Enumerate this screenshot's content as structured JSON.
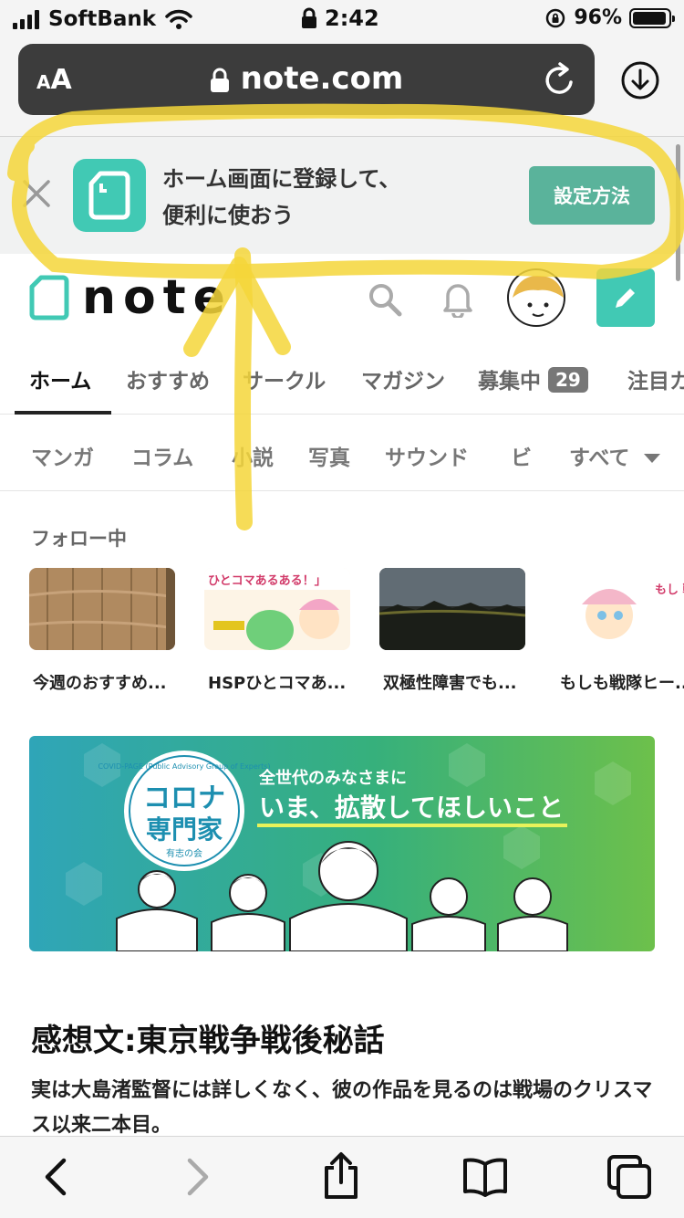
{
  "status_bar": {
    "carrier": "SoftBank",
    "time": "2:42",
    "battery_percent": "96%",
    "battery_level": 0.96
  },
  "address_bar": {
    "text_size_small": "A",
    "text_size_large": "A",
    "domain": "note.com"
  },
  "install_banner": {
    "line1": "ホーム画面に登録して、",
    "line2": "便利に使おう",
    "button": "設定方法"
  },
  "site": {
    "brand": "note"
  },
  "tabs": [
    {
      "label": "ホーム",
      "active": true
    },
    {
      "label": "おすすめ"
    },
    {
      "label": "サークル"
    },
    {
      "label": "マガジン"
    },
    {
      "label": "募集中",
      "badge": "29"
    },
    {
      "label": "注目カ"
    }
  ],
  "categories": [
    "マンガ",
    "コラム",
    "小説",
    "写真",
    "サウンド",
    "ビ",
    "すべて"
  ],
  "following": {
    "title": "フォロー中",
    "items": [
      {
        "caption": "今週のおすすめ..."
      },
      {
        "caption": "HSPひとコマあ..."
      },
      {
        "caption": "双極性障害でも..."
      },
      {
        "caption": "もしも戦隊ヒー..."
      }
    ],
    "thumb2_text": "ひとコマあるある！」",
    "thumb4_text": "もし 戦隊ヒ ひ HSP"
  },
  "hero": {
    "badge_top": "COVID-PAGE (Public Advisory Group of Experts)",
    "badge_main_1": "コロナ",
    "badge_main_2": "専門家",
    "badge_sub": "有志の会",
    "subtitle": "全世代のみなさまに",
    "headline": "いま、拡散してほしいこと"
  },
  "article": {
    "title": "感想文:東京戦争戦後秘話",
    "body": "実は大島渚監督には詳しくなく、彼の作品を見るのは戦場のクリスマス以来二本目。"
  },
  "colors": {
    "note_green": "#41c9b4",
    "button_green": "#5ab39b",
    "annotation_yellow": "#f5d63a"
  }
}
